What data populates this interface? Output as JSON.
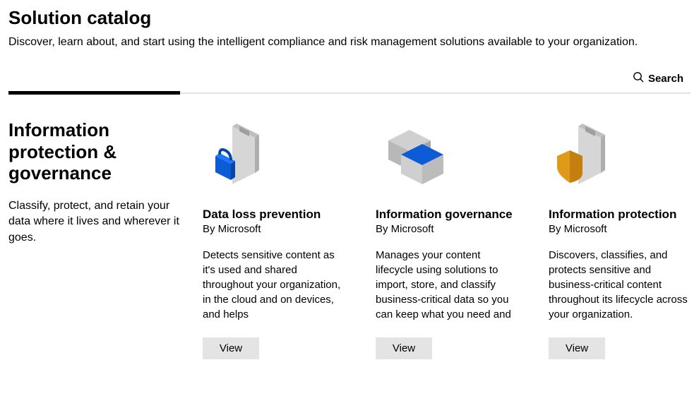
{
  "page": {
    "title": "Solution catalog",
    "subtitle": "Discover, learn about, and start using the intelligent compliance and risk management solutions available to your organization.",
    "search_label": "Search"
  },
  "section": {
    "title": "Information protection & governance",
    "description": "Classify, protect, and retain your data where it lives and wherever it goes."
  },
  "cards": [
    {
      "title": "Data loss prevention",
      "publisher": "By Microsoft",
      "description": "Detects sensitive content as it's used and shared throughout your organization, in the cloud and on devices, and helps",
      "view_label": "View"
    },
    {
      "title": "Information governance",
      "publisher": "By Microsoft",
      "description": "Manages your content lifecycle using solutions to import, store, and classify business-critical data so you can keep what you need and",
      "view_label": "View"
    },
    {
      "title": "Information protection",
      "publisher": "By Microsoft",
      "description": "Discovers, classifies, and protects sensitive and business-critical content throughout its lifecycle across your organization.",
      "view_label": "View"
    }
  ]
}
